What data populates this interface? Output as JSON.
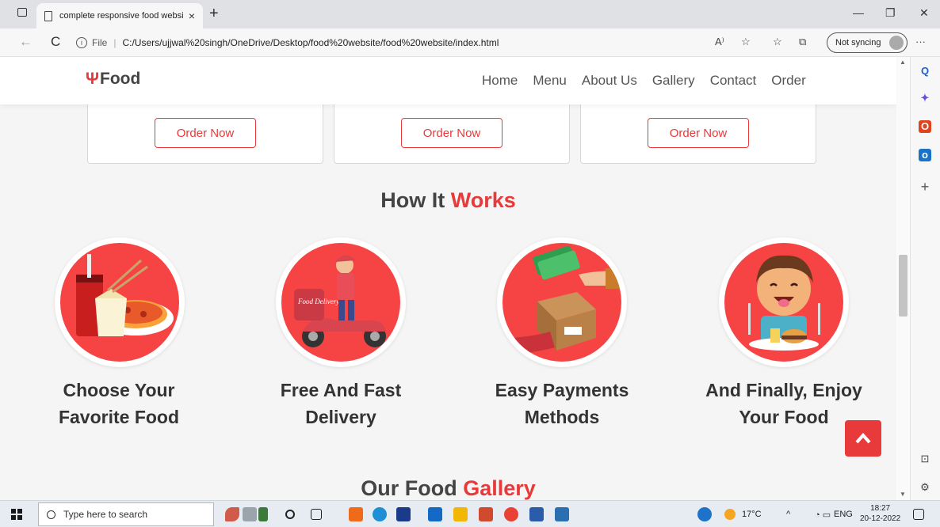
{
  "browser": {
    "tab_title": "complete responsive food websi",
    "tab_close": "×",
    "new_tab": "+",
    "minimize": "—",
    "restore": "❐",
    "close": "✕",
    "back": "←",
    "reload": "C",
    "info_glyph": "i",
    "file_label": "File",
    "url_sep": "|",
    "url": "C:/Users/ujjwal%20singh/OneDrive/Desktop/food%20website/food%20website/index.html",
    "read_aloud_icon": "A⁾",
    "favorites_add_icon": "☆",
    "favorites_icon": "☆",
    "collections_icon": "⧉",
    "sync_label": "Not syncing",
    "more_icon": "···"
  },
  "sidebar": {
    "search_glyph": "Q",
    "copilot_glyph": "✦",
    "office_glyph": "O",
    "outlook_glyph": "o",
    "add_glyph": "+",
    "panel_glyph": "⊡",
    "settings_glyph": "⚙"
  },
  "site": {
    "logo_icon": "Ψ",
    "logo_text": "Food",
    "nav": [
      "Home",
      "Menu",
      "About Us",
      "Gallery",
      "Contact",
      "Order"
    ],
    "order_btn": "Order Now",
    "how_prefix": "How It",
    "how_accent": "Works",
    "steps": [
      {
        "line1": "Choose Your",
        "line2": "Favorite Food",
        "icon": "food-combo"
      },
      {
        "line1": "Free And Fast",
        "line2": "Delivery",
        "icon": "delivery-scooter"
      },
      {
        "line1": "Easy Payments",
        "line2": "Methods",
        "icon": "payment-handover"
      },
      {
        "line1": "And Finally, Enjoy",
        "line2": "Your Food",
        "icon": "enjoy-food"
      }
    ],
    "gallery_prefix": "Our Food",
    "gallery_accent": "Gallery",
    "accent_color": "#e83a3a",
    "circle_color": "#f64444",
    "delivery_box_text": "Food Delivery"
  },
  "taskbar": {
    "search_placeholder": "Type here to search",
    "weather": "17°C",
    "language": "ENG",
    "time": "18:27",
    "date": "20-12-2022"
  }
}
